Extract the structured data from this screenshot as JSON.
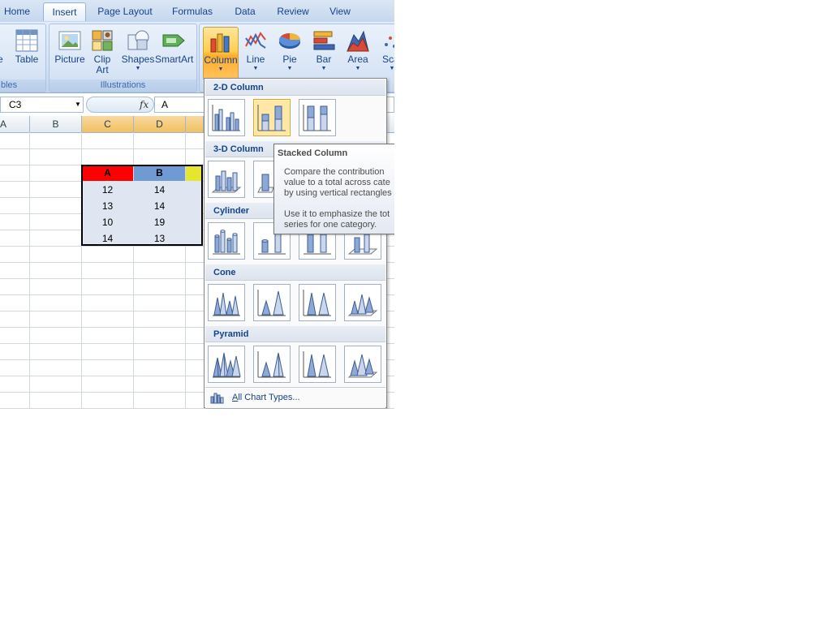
{
  "tabs": [
    "Home",
    "Insert",
    "Page Layout",
    "Formulas",
    "Data",
    "Review",
    "View"
  ],
  "ribbon": {
    "tables_group_label": "bles",
    "pivot_label": "le",
    "table_label": "Table",
    "illustrations_group_label": "Illustrations",
    "picture_label": "Picture",
    "clipart_label_1": "Clip",
    "clipart_label_2": "Art",
    "shapes_label": "Shapes",
    "smartart_label": "SmartArt",
    "column_label": "Column",
    "line_label": "Line",
    "pie_label": "Pie",
    "bar_label": "Bar",
    "area_label": "Area",
    "scatter_label": "Scat"
  },
  "formula_bar": {
    "name_box": "C3",
    "fx": "fx",
    "content": "A"
  },
  "grid": {
    "columns": [
      "A",
      "B",
      "C",
      "D"
    ],
    "table_headers": [
      "A",
      "B"
    ],
    "rows": [
      [
        "12",
        "14"
      ],
      [
        "13",
        "14"
      ],
      [
        "10",
        "19"
      ],
      [
        "14",
        "13"
      ]
    ],
    "colors": {
      "header_a": "#ff0000",
      "header_b": "#6f9ad4",
      "header_c": "#e6e62e",
      "selected_cols": "#f7cf7f"
    }
  },
  "gallery": {
    "sections": [
      "2-D Column",
      "3-D Column",
      "Cylinder",
      "Cone",
      "Pyramid"
    ],
    "all_chart_types": "All Chart Types..."
  },
  "tooltip": {
    "title": "Stacked Column",
    "lines": [
      "Compare the contribution",
      "value to a total across cate",
      "by using vertical rectangles",
      "",
      "Use it to emphasize the tot",
      "series for one category."
    ]
  }
}
